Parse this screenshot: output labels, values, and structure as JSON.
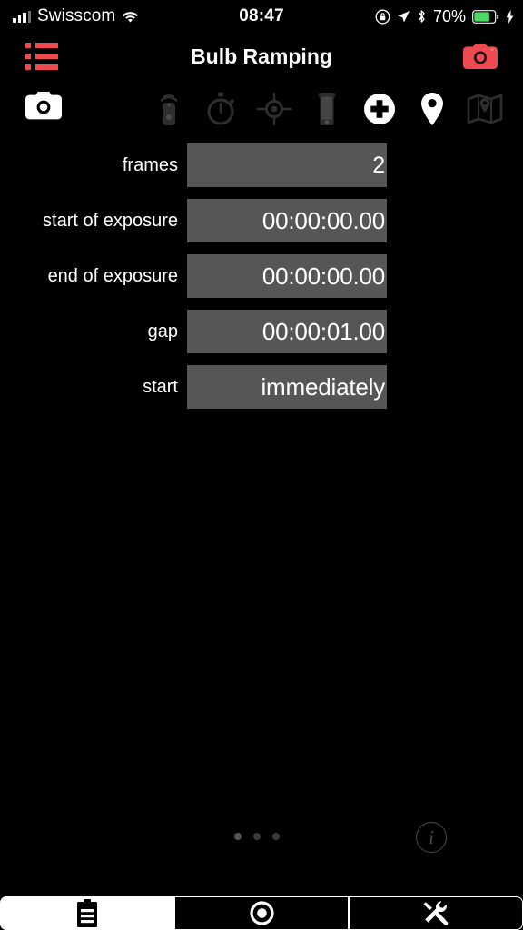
{
  "status_bar": {
    "carrier": "Swisscom",
    "time": "08:47",
    "battery_percent": "70%",
    "icons": {
      "signal": "signal-bars-icon",
      "wifi": "wifi-icon",
      "rotation_lock": "rotation-lock-icon",
      "location": "location-arrow-icon",
      "bluetooth": "bluetooth-icon",
      "battery": "battery-icon",
      "charging": "charging-bolt-icon"
    },
    "battery_color": "#4cd964"
  },
  "nav_bar": {
    "title": "Bulb Ramping",
    "left_icon": "list-icon",
    "right_icon": "camera-icon",
    "accent_color": "#ef4a4f"
  },
  "toolbar": {
    "items": [
      {
        "name": "camera-icon",
        "state": "active"
      },
      {
        "name": "remote-icon",
        "state": "dimmed"
      },
      {
        "name": "stopwatch-icon",
        "state": "dimmed"
      },
      {
        "name": "crosshair-icon",
        "state": "dimmed"
      },
      {
        "name": "device-icon",
        "state": "dimmed"
      },
      {
        "name": "plus-circle-icon",
        "state": "active"
      },
      {
        "name": "location-pin-icon",
        "state": "active"
      },
      {
        "name": "map-icon",
        "state": "dimmed"
      }
    ]
  },
  "form": {
    "fields": [
      {
        "label": "frames",
        "value": "2"
      },
      {
        "label": "start of exposure",
        "value": "00:00:00.00"
      },
      {
        "label": "end of exposure",
        "value": "00:00:00.00"
      },
      {
        "label": "gap",
        "value": "00:00:01.00"
      },
      {
        "label": "start",
        "value": "immediately"
      }
    ]
  },
  "pager": {
    "count": 3,
    "active_index": 0
  },
  "info_button": {
    "label": "i"
  },
  "tab_bar": {
    "tabs": [
      {
        "name": "clipboard-tab",
        "icon": "clipboard-icon",
        "selected": true
      },
      {
        "name": "shutter-tab",
        "icon": "record-circle-icon",
        "selected": false
      },
      {
        "name": "tools-tab",
        "icon": "tools-icon",
        "selected": false
      }
    ]
  }
}
